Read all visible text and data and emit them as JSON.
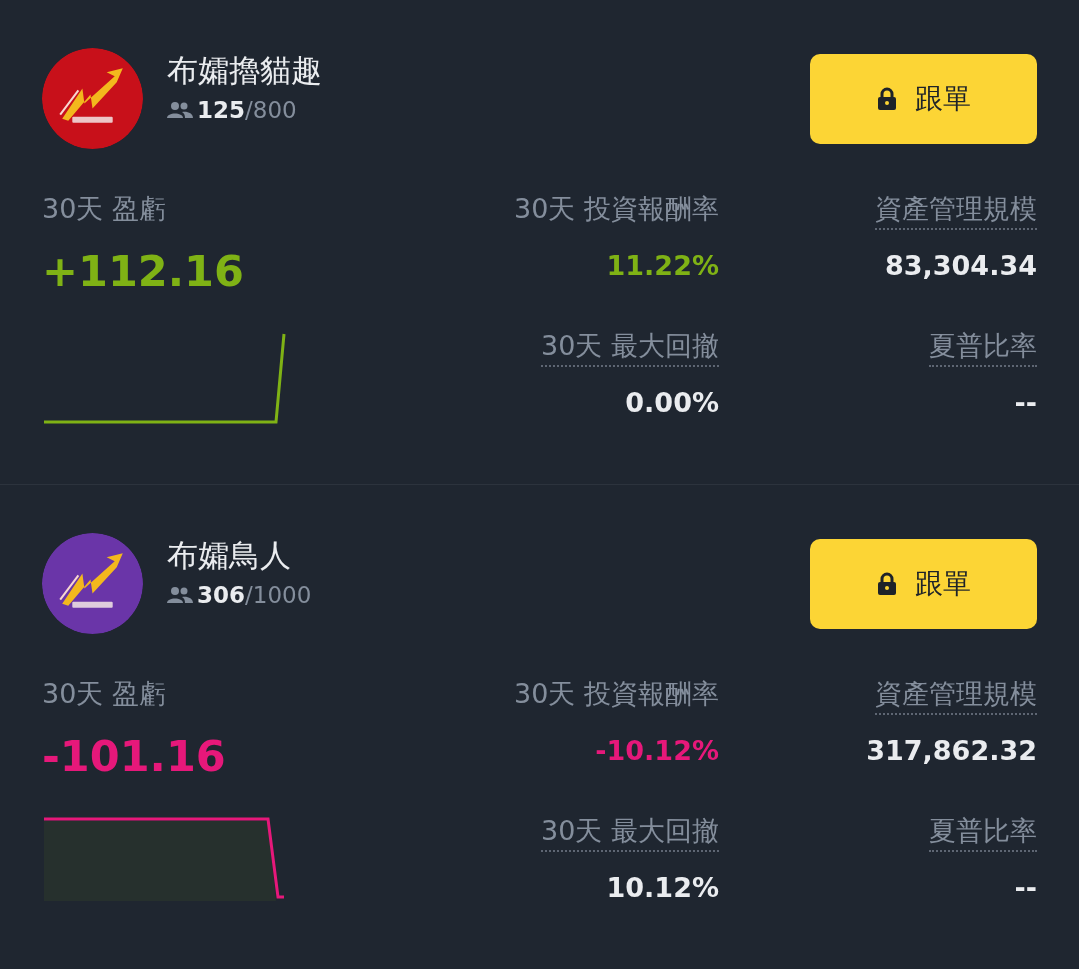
{
  "traders": [
    {
      "name": "布孀擼貓趣",
      "color": "#c8101a",
      "followers": "125",
      "capacity": "/800",
      "button": {
        "label": "跟單",
        "locked": true
      },
      "pnl": {
        "label": "30天 盈虧",
        "value": "+112.16",
        "kind": "up"
      },
      "metrics": [
        {
          "label": "30天 投資報酬率",
          "value": "11.22%",
          "underlined": false,
          "kind": "up"
        },
        {
          "label": "資產管理規模",
          "value": "83,304.34",
          "underlined": true,
          "kind": "neutral"
        },
        {
          "label": "30天 最大回撤",
          "value": "0.00%",
          "underlined": true,
          "kind": "neutral"
        },
        {
          "label": "夏普比率",
          "value": "--",
          "underlined": true,
          "kind": "neutral"
        }
      ]
    },
    {
      "name": "布孀鳥人",
      "color": "#6a35a8",
      "followers": "306",
      "capacity": "/1000",
      "button": {
        "label": "跟單",
        "locked": true
      },
      "pnl": {
        "label": "30天 盈虧",
        "value": "-101.16",
        "kind": "down"
      },
      "metrics": [
        {
          "label": "30天 投資報酬率",
          "value": "-10.12%",
          "underlined": false,
          "kind": "down"
        },
        {
          "label": "資產管理規模",
          "value": "317,862.32",
          "underlined": true,
          "kind": "neutral"
        },
        {
          "label": "30天 最大回撤",
          "value": "10.12%",
          "underlined": true,
          "kind": "neutral"
        },
        {
          "label": "夏普比率",
          "value": "--",
          "underlined": true,
          "kind": "neutral"
        }
      ]
    }
  ]
}
